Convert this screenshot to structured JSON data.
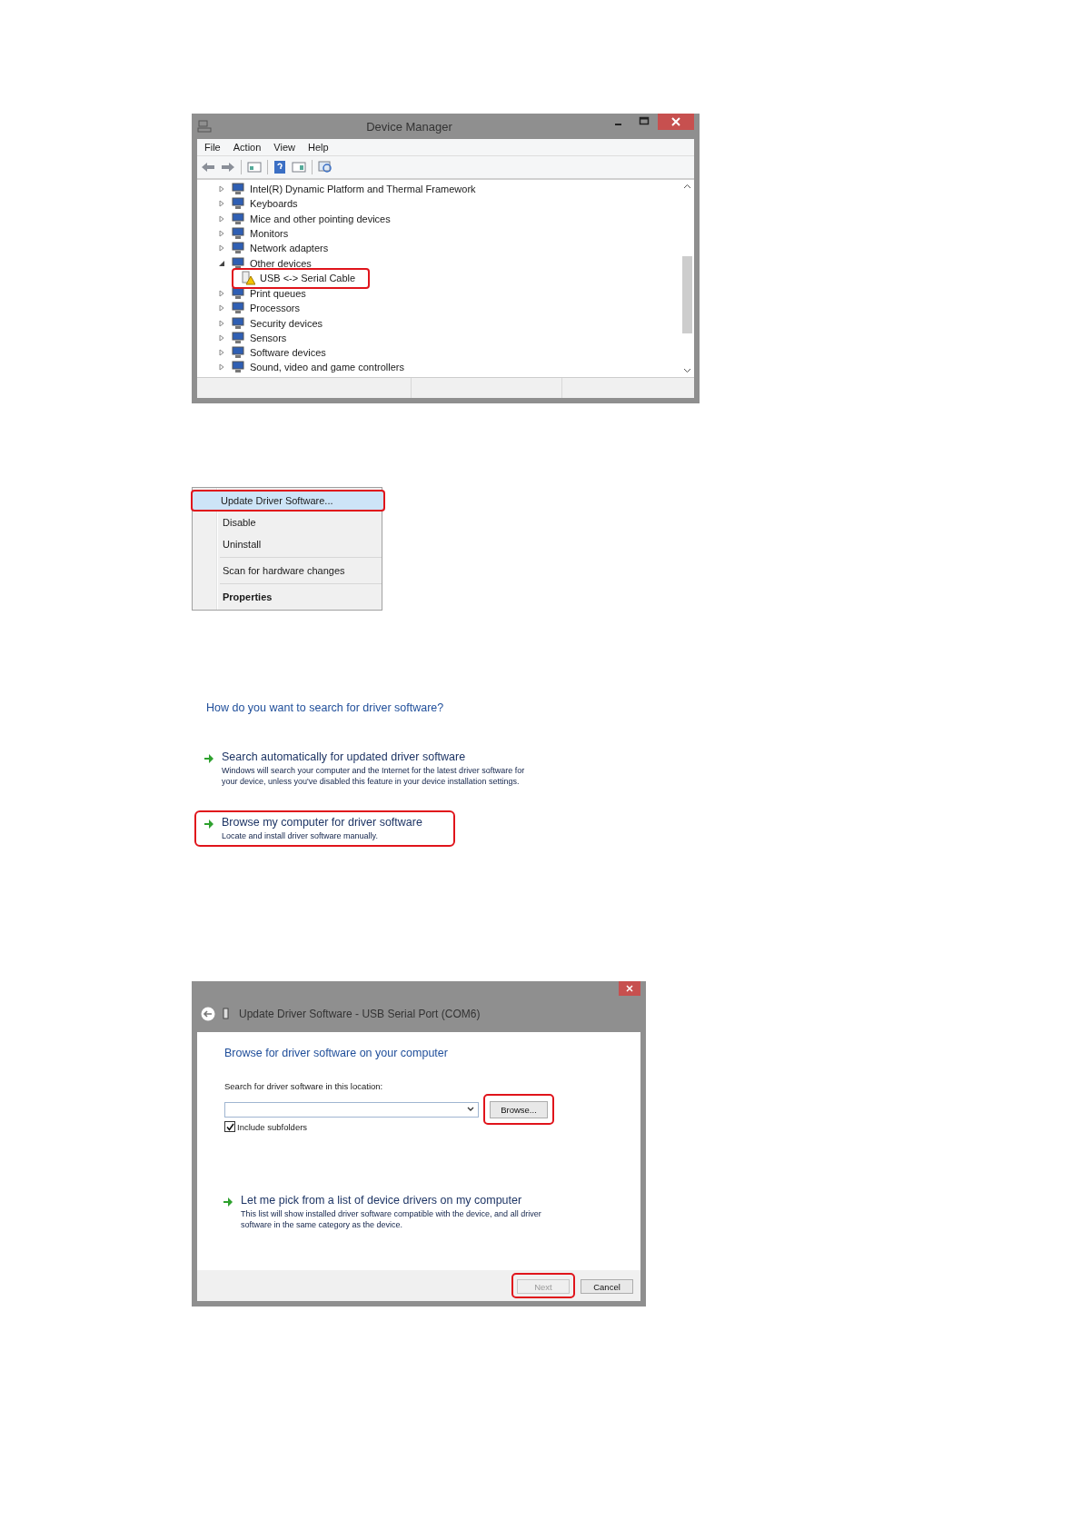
{
  "device_manager": {
    "title": "Device Manager",
    "menu": [
      "File",
      "Action",
      "View",
      "Help"
    ],
    "tree": [
      {
        "label": "Intel(R) Dynamic Platform and Thermal Framework",
        "expanded": false,
        "highlighted": false
      },
      {
        "label": "Keyboards",
        "expanded": false,
        "highlighted": false
      },
      {
        "label": "Mice and other pointing devices",
        "expanded": false,
        "highlighted": false
      },
      {
        "label": "Monitors",
        "expanded": false,
        "highlighted": false
      },
      {
        "label": "Network adapters",
        "expanded": false,
        "highlighted": false
      },
      {
        "label": "Other devices",
        "expanded": true,
        "highlighted": false,
        "children": [
          {
            "label": "USB <-> Serial Cable",
            "highlighted": true,
            "warning": true
          }
        ]
      },
      {
        "label": "Print queues",
        "expanded": false,
        "highlighted": false
      },
      {
        "label": "Processors",
        "expanded": false,
        "highlighted": false
      },
      {
        "label": "Security devices",
        "expanded": false,
        "highlighted": false
      },
      {
        "label": "Sensors",
        "expanded": false,
        "highlighted": false
      },
      {
        "label": "Software devices",
        "expanded": false,
        "highlighted": false
      },
      {
        "label": "Sound, video and game controllers",
        "expanded": false,
        "highlighted": false
      }
    ]
  },
  "context_menu": [
    {
      "kind": "item",
      "label": "Update Driver Software...",
      "highlighted": true,
      "default": false
    },
    {
      "kind": "item",
      "label": "Disable",
      "highlighted": false,
      "default": false
    },
    {
      "kind": "item",
      "label": "Uninstall",
      "highlighted": false,
      "default": false
    },
    {
      "kind": "separator"
    },
    {
      "kind": "item",
      "label": "Scan for hardware changes",
      "highlighted": false,
      "default": false
    },
    {
      "kind": "separator"
    },
    {
      "kind": "item",
      "label": "Properties",
      "highlighted": false,
      "default": true
    }
  ],
  "search_choice": {
    "heading": "How do you want to search for driver software?",
    "options": [
      {
        "title": "Search automatically for updated driver software",
        "description": "Windows will search your computer and the Internet for the latest driver software for your device, unless you've disabled this feature in your device installation settings.",
        "highlighted": false
      },
      {
        "title": "Browse my computer for driver software",
        "description": "Locate and install driver software manually.",
        "highlighted": true
      }
    ]
  },
  "update_dialog": {
    "title": "Update Driver Software - USB Serial Port (COM6)",
    "heading": "Browse for driver software on your computer",
    "field_label": "Search for driver software in this location:",
    "browse_button": {
      "label": "Browse...",
      "highlighted": true
    },
    "checkbox": {
      "label": "Include subfolders",
      "checked": true
    },
    "option": {
      "title": "Let me pick from a list of device drivers on my computer",
      "description": "This list will show installed driver software compatible with the device, and all driver software in the same category as the device.",
      "highlighted": false
    },
    "buttons": [
      {
        "label": "Next",
        "disabled": true,
        "highlighted": true
      },
      {
        "label": "Cancel",
        "disabled": false,
        "highlighted": false
      }
    ]
  }
}
